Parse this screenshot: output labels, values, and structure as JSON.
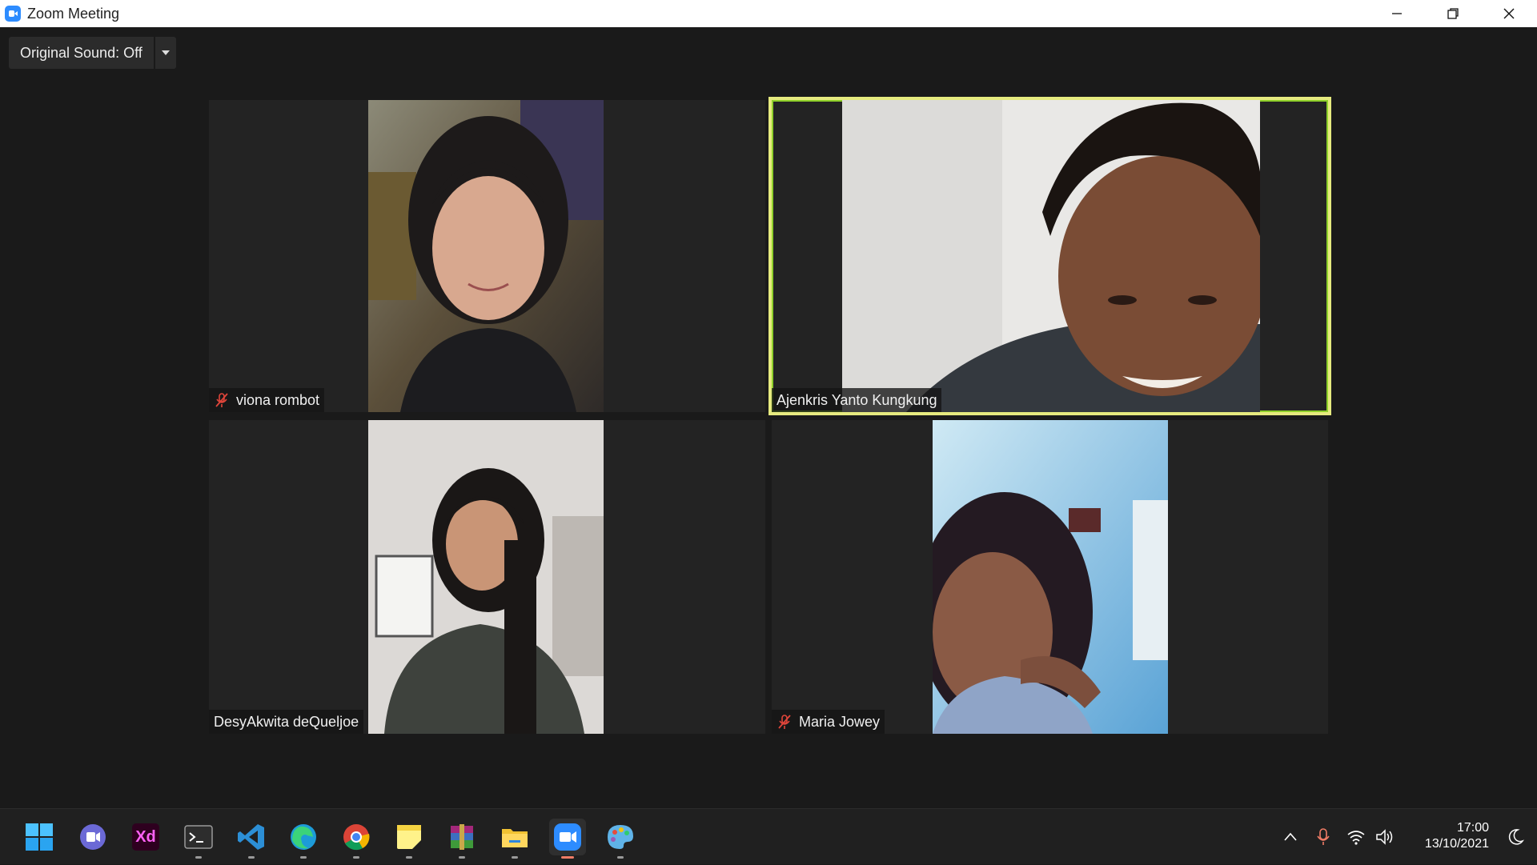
{
  "window": {
    "title": "Zoom Meeting",
    "controls": {
      "minimize": "—",
      "restore": "❐",
      "close": "✕"
    }
  },
  "audio": {
    "original_sound_label": "Original Sound: Off"
  },
  "participants": [
    {
      "name": "viona rombot",
      "muted": true,
      "active_speaker": false
    },
    {
      "name": "Ajenkris Yanto Kungkung",
      "muted": false,
      "active_speaker": true
    },
    {
      "name": "DesyAkwita deQueljoe",
      "muted": false,
      "active_speaker": false
    },
    {
      "name": "Maria Jowey",
      "muted": true,
      "active_speaker": false
    }
  ],
  "taskbar": {
    "apps": [
      {
        "name": "windows-start-icon"
      },
      {
        "name": "teams-chat-icon"
      },
      {
        "name": "adobe-xd-icon",
        "label": "Xd"
      },
      {
        "name": "terminal-icon"
      },
      {
        "name": "vscode-icon"
      },
      {
        "name": "edge-icon"
      },
      {
        "name": "chrome-icon"
      },
      {
        "name": "sticky-notes-icon"
      },
      {
        "name": "winrar-icon"
      },
      {
        "name": "file-explorer-icon"
      },
      {
        "name": "zoom-icon"
      },
      {
        "name": "paint-icon"
      }
    ],
    "clock": {
      "time": "17:00",
      "date": "13/10/2021"
    }
  },
  "colors": {
    "accent": "#2d8cff",
    "active_speaker_border": "#e6ea7f",
    "mute_red": "#e0453a"
  }
}
